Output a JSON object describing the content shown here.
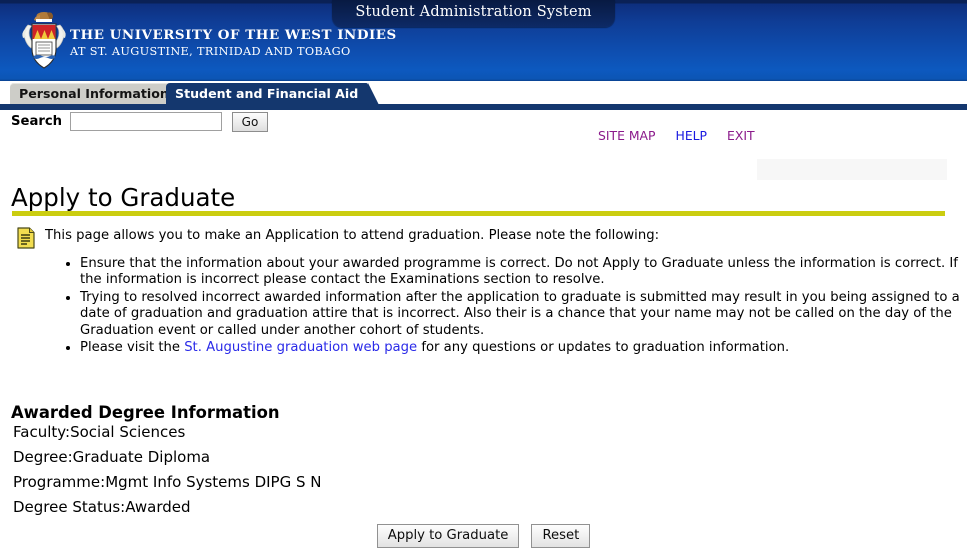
{
  "banner": {
    "system_title": "Student Administration System",
    "university_line1": "THE UNIVERSITY OF THE WEST INDIES",
    "university_line2": "AT ST. AUGUSTINE, TRINIDAD AND TOBAGO",
    "crest_icon": "uwi-crest-icon",
    "colors": {
      "banner_top": "#0a2156",
      "banner_bottom": "#0d59bf",
      "title_tab_bg": "#0b2357"
    }
  },
  "tabs": [
    {
      "label": "Personal Information",
      "active": false
    },
    {
      "label": "Student and Financial Aid",
      "active": true
    }
  ],
  "search": {
    "label": "Search",
    "value": "",
    "placeholder": "",
    "go_label": "Go"
  },
  "nav_links": [
    {
      "label": "SITE MAP",
      "state": "visited"
    },
    {
      "label": "HELP",
      "state": "unvisited"
    },
    {
      "label": "EXIT",
      "state": "visited"
    }
  ],
  "page": {
    "title": "Apply to Graduate",
    "rule_color": "#cbcd10",
    "note_icon": "note-document-icon",
    "note_text": "This page allows you to make an Application to attend graduation. Please note the following:",
    "bullets": [
      {
        "text_before": "Ensure that the information about your awarded programme is correct. Do not Apply to Graduate unless the information is correct. If the information is incorrect please contact the Examinations section to resolve.",
        "link": "",
        "text_after": ""
      },
      {
        "text_before": "Trying to resolved incorrect awarded information after the application to graduate is submitted may result in you being assigned to a date of graduation and graduation attire that is incorrect. Also their is a chance that your name may not be called on the day of the Graduation event or called under another cohort of students.",
        "link": "",
        "text_after": ""
      },
      {
        "text_before": "Please visit the ",
        "link": "St. Augustine graduation web page",
        "text_after": " for any questions or updates to graduation information."
      }
    ]
  },
  "awarded_degree": {
    "heading": "Awarded Degree Information",
    "rows": [
      {
        "label": "Faculty:",
        "value": "Social Sciences"
      },
      {
        "label": "Degree:",
        "value": "Graduate Diploma"
      },
      {
        "label": "Programme:",
        "value": "Mgmt Info Systems DIPG S N"
      },
      {
        "label": "Degree Status:",
        "value": "Awarded"
      }
    ]
  },
  "actions": {
    "apply_label": "Apply to Graduate",
    "reset_label": "Reset"
  }
}
